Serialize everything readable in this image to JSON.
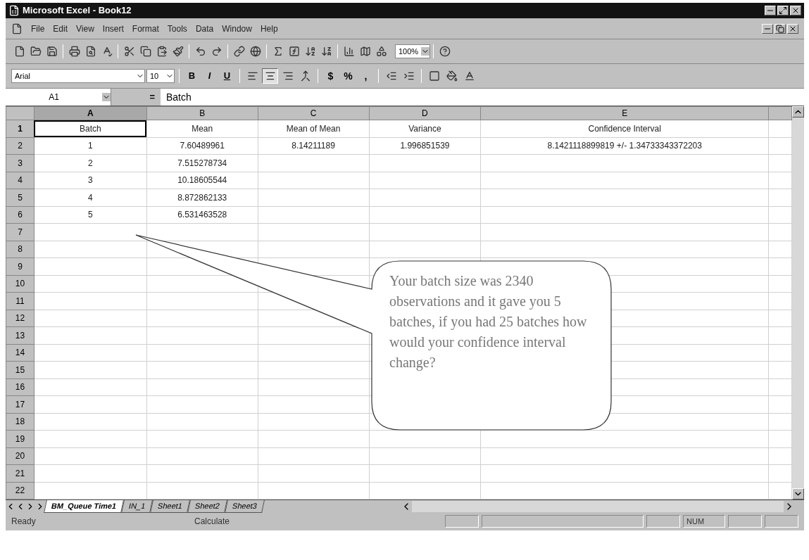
{
  "window": {
    "title": "Microsoft Excel - Book12"
  },
  "menu": [
    "File",
    "Edit",
    "View",
    "Insert",
    "Format",
    "Tools",
    "Data",
    "Window",
    "Help"
  ],
  "standard_toolbar": {
    "zoom": "100%"
  },
  "format_toolbar": {
    "font": "Arial",
    "size": "10",
    "style_buttons": [
      "B",
      "I",
      "U"
    ],
    "align_buttons": [
      {
        "selected": false
      },
      {
        "selected": true
      },
      {
        "selected": false
      }
    ],
    "number_buttons": [
      "$",
      "%",
      ","
    ]
  },
  "formula_bar": {
    "name_box": "A1",
    "equals": "=",
    "value": "Batch"
  },
  "sheet": {
    "columns": [
      {
        "label": "A",
        "selected": true
      },
      {
        "label": "B",
        "selected": false
      },
      {
        "label": "C",
        "selected": false
      },
      {
        "label": "D",
        "selected": false
      },
      {
        "label": "E",
        "selected": false
      }
    ],
    "rows": [
      {
        "num": "1",
        "cells": [
          "Batch",
          "Mean",
          "Mean of Mean",
          "Variance",
          "Confidence Interval"
        ]
      },
      {
        "num": "2",
        "cells": [
          "1",
          "7.60489961",
          "8.14211189",
          "1.996851539",
          "8.1421118899819 +/- 1.34733343372203"
        ]
      },
      {
        "num": "3",
        "cells": [
          "2",
          "7.515278734",
          "",
          "",
          ""
        ]
      },
      {
        "num": "4",
        "cells": [
          "3",
          "10.18605544",
          "",
          "",
          ""
        ]
      },
      {
        "num": "5",
        "cells": [
          "4",
          "8.872862133",
          "",
          "",
          ""
        ]
      },
      {
        "num": "6",
        "cells": [
          "5",
          "6.531463528",
          "",
          "",
          ""
        ]
      },
      {
        "num": "7",
        "cells": []
      },
      {
        "num": "8",
        "cells": []
      },
      {
        "num": "9",
        "cells": []
      },
      {
        "num": "10",
        "cells": []
      },
      {
        "num": "11",
        "cells": []
      },
      {
        "num": "12",
        "cells": []
      },
      {
        "num": "13",
        "cells": []
      },
      {
        "num": "14",
        "cells": []
      },
      {
        "num": "15",
        "cells": []
      },
      {
        "num": "16",
        "cells": []
      },
      {
        "num": "17",
        "cells": []
      },
      {
        "num": "18",
        "cells": []
      },
      {
        "num": "19",
        "cells": []
      },
      {
        "num": "20",
        "cells": []
      },
      {
        "num": "21",
        "cells": []
      },
      {
        "num": "22",
        "cells": []
      }
    ]
  },
  "callout": {
    "text": "Your batch size was 2340 observations and it gave you 5 batches, if you had 25 batches how would your confidence interval change?"
  },
  "sheet_tabs": [
    {
      "label": "BM_Queue Time1",
      "selected": true
    },
    {
      "label": "IN_1",
      "selected": false
    },
    {
      "label": "Sheet1",
      "selected": false
    },
    {
      "label": "Sheet2",
      "selected": false
    },
    {
      "label": "Sheet3",
      "selected": false
    }
  ],
  "status_bar": {
    "left": "Ready",
    "middle": "Calculate",
    "indicator": "NUM"
  }
}
